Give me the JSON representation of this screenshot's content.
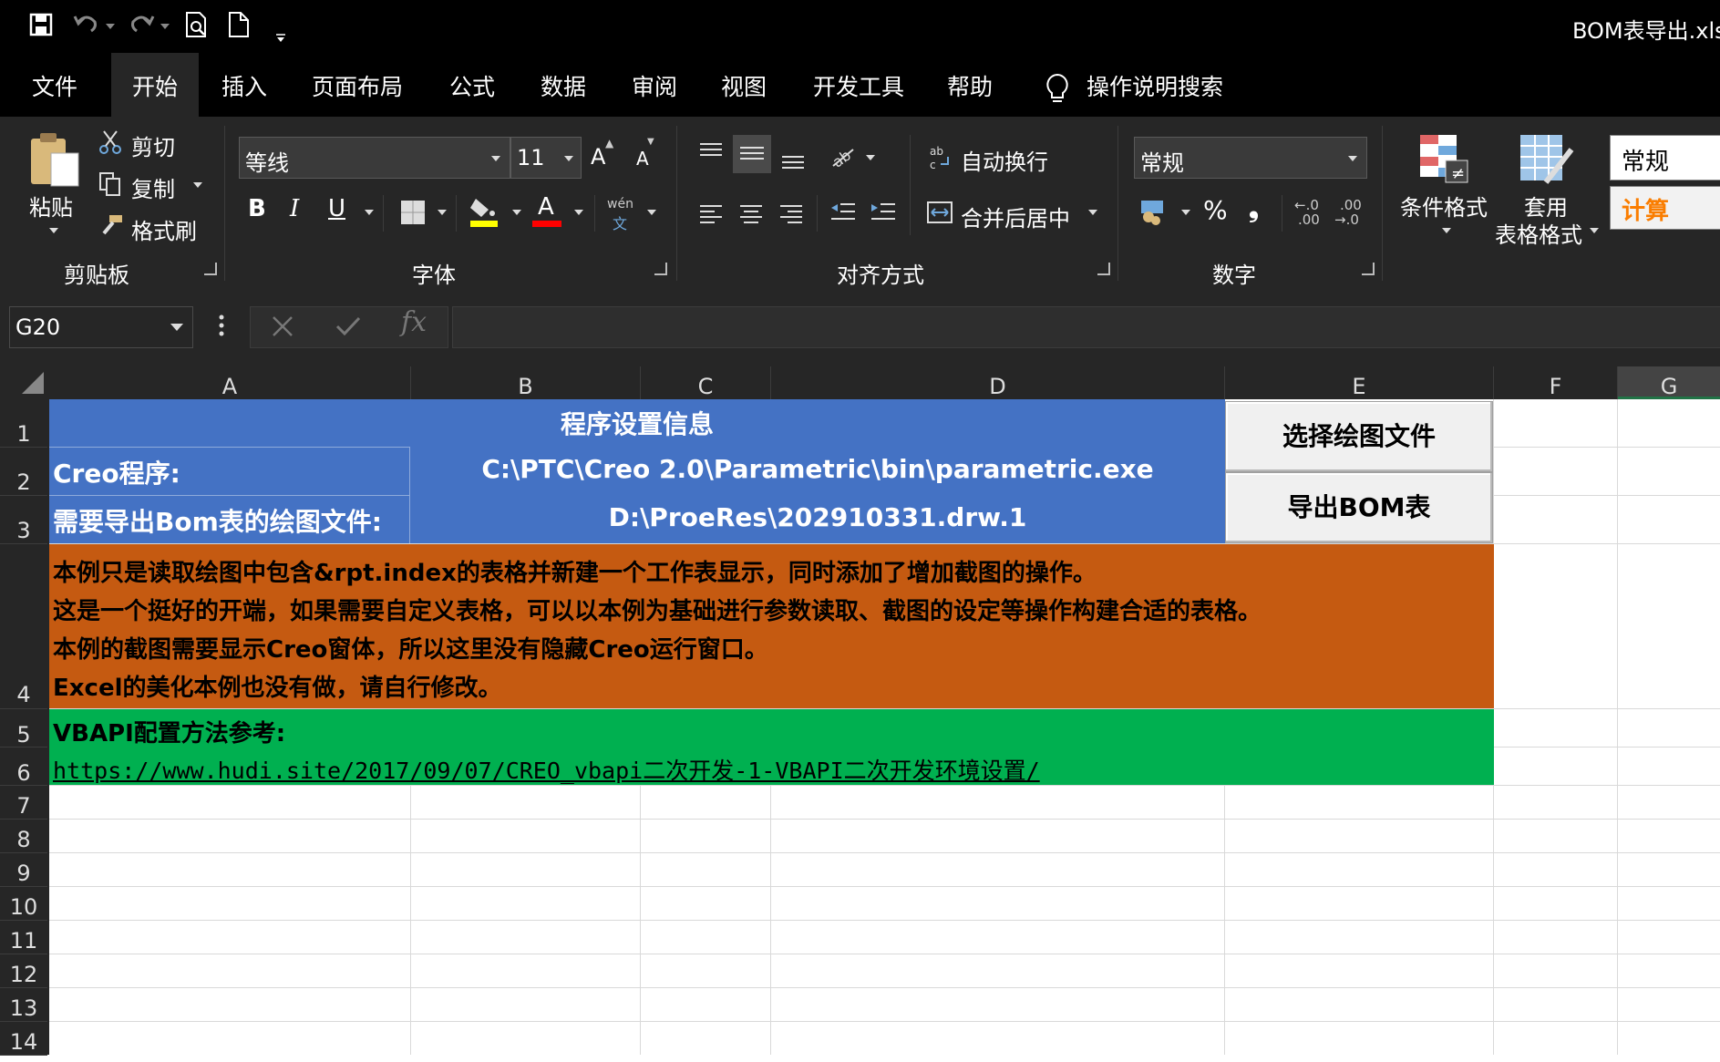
{
  "window": {
    "title": "BOM表导出.xls"
  },
  "tabs": [
    "文件",
    "开始",
    "插入",
    "页面布局",
    "公式",
    "数据",
    "审阅",
    "视图",
    "开发工具",
    "帮助",
    "操作说明搜索"
  ],
  "ribbon": {
    "clipboard": {
      "paste": "粘贴",
      "cut": "剪切",
      "copy": "复制",
      "format_painter": "格式刷",
      "label": "剪贴板"
    },
    "font": {
      "name": "等线",
      "size": "11",
      "label": "字体",
      "bold": "B",
      "italic": "I",
      "underline": "U",
      "grow": "A",
      "shrink": "A",
      "phonetic_top": "wén",
      "phonetic_bottom": "文",
      "font_color": "A"
    },
    "alignment": {
      "wrap": "自动换行",
      "merge": "合并后居中",
      "label": "对齐方式"
    },
    "number": {
      "format": "常规",
      "percent": "%",
      "comma": "❟",
      "inc_top": "←.0",
      "inc_bottom": ".00",
      "dec_top": ".00",
      "dec_bottom": "→.0",
      "label": "数字"
    },
    "styles": {
      "conditional": "条件格式",
      "table_line1": "套用",
      "table_line2": "表格格式",
      "style_normal": "常规",
      "style_calc": "计算"
    }
  },
  "formula_bar": {
    "name_box": "G20",
    "fx": "fx",
    "content": ""
  },
  "columns": [
    "A",
    "B",
    "C",
    "D",
    "E",
    "F",
    "G"
  ],
  "rows": [
    "1",
    "2",
    "3",
    "4",
    "5",
    "6",
    "7",
    "8",
    "9",
    "10",
    "11",
    "12",
    "13",
    "14"
  ],
  "sheet": {
    "title": "程序设置信息",
    "creo_label": "Creo程序:",
    "creo_path": "C:\\PTC\\Creo 2.0\\Parametric\\bin\\parametric.exe",
    "drawing_label": "需要导出Bom表的绘图文件:",
    "drawing_path": "D:\\ProeRes\\202910331.drw.1",
    "notes": [
      "本例只是读取绘图中包含&rpt.index的表格并新建一个工作表显示，同时添加了增加截图的操作。",
      "这是一个挺好的开端，如果需要自定义表格，可以以本例为基础进行参数读取、截图的设定等操作构建合适的表格。",
      "本例的截图需要显示Creo窗体，所以这里没有隐藏Creo运行窗口。",
      "Excel的美化本例也没有做，请自行修改。"
    ],
    "vbapi_label": "VBAPI配置方法参考:",
    "vbapi_link": "https://www.hudi.site/2017/09/07/CREO_vbapi二次开发-1-VBAPI二次开发环境设置/",
    "btn_select": "选择绘图文件",
    "btn_export": "导出BOM表"
  },
  "colors": {
    "header_blue": "#4472c4",
    "notes_orange": "#c55a11",
    "link_green": "#00b050",
    "ribbon_bg": "#262626",
    "titlebar_bg": "#000000"
  }
}
